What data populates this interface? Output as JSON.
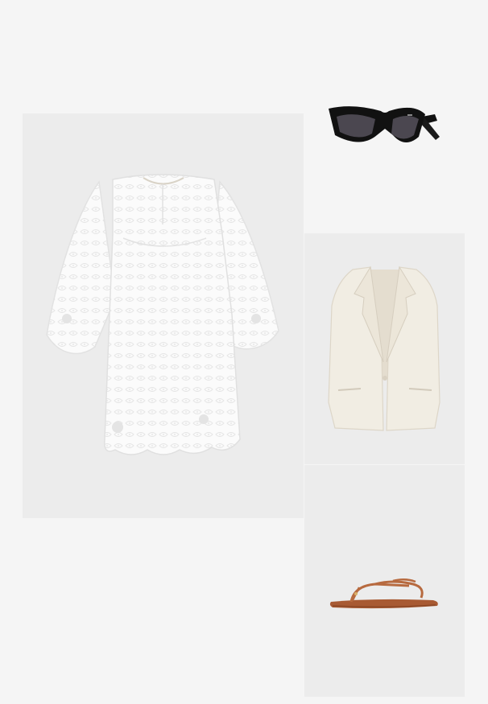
{
  "board": {
    "items": [
      {
        "id": "dress",
        "icon": "dress-icon",
        "color": "#fbfbfb"
      },
      {
        "id": "sunglasses",
        "icon": "sunglasses-icon",
        "color": "#111111"
      },
      {
        "id": "vest",
        "icon": "vest-icon",
        "color": "#f1ede3"
      },
      {
        "id": "sandal",
        "icon": "sandal-icon",
        "color": "#b76a3f"
      }
    ]
  }
}
